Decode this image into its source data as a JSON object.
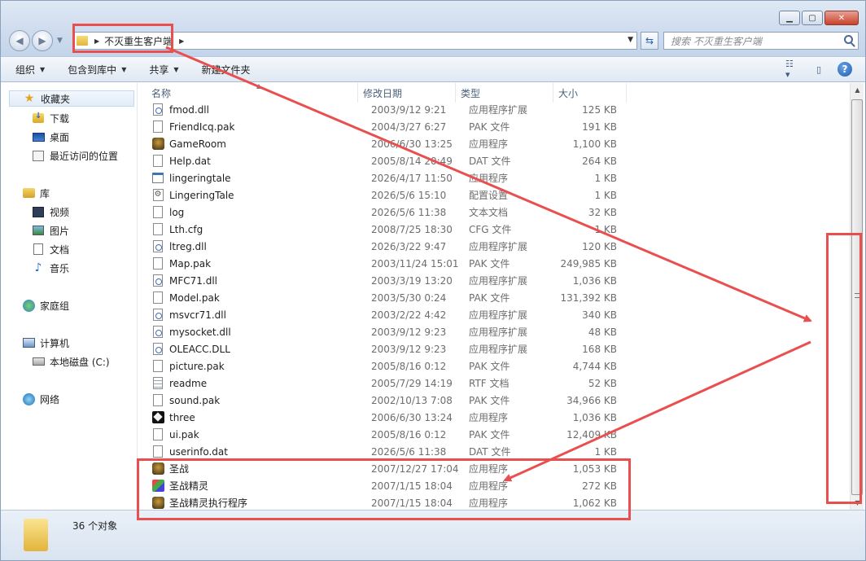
{
  "address": {
    "crumb": "不灭重生客户端"
  },
  "search": {
    "placeholder": "搜索 不灭重生客户端"
  },
  "toolbar": {
    "organize": "组织",
    "include_library": "包含到库中",
    "share": "共享",
    "new_folder": "新建文件夹"
  },
  "sidebar": {
    "favorites": "收藏夹",
    "downloads": "下载",
    "desktop": "桌面",
    "recent": "最近访问的位置",
    "libraries": "库",
    "videos": "视频",
    "pictures": "图片",
    "documents": "文档",
    "music": "音乐",
    "homegroup": "家庭组",
    "computer": "计算机",
    "local_disk": "本地磁盘 (C:)",
    "network": "网络"
  },
  "columns": {
    "name": "名称",
    "date": "修改日期",
    "type": "类型",
    "size": "大小"
  },
  "files": [
    {
      "name": "fmod.dll",
      "date": "2003/9/12 9:21",
      "type": "应用程序扩展",
      "size": "125 KB",
      "icon": "dll"
    },
    {
      "name": "FriendIcq.pak",
      "date": "2004/3/27 6:27",
      "type": "PAK 文件",
      "size": "191 KB",
      "icon": "file"
    },
    {
      "name": "GameRoom",
      "date": "2006/6/30 13:25",
      "type": "应用程序",
      "size": "1,100 KB",
      "icon": "exe"
    },
    {
      "name": "Help.dat",
      "date": "2005/8/14 20:49",
      "type": "DAT 文件",
      "size": "264 KB",
      "icon": "file"
    },
    {
      "name": "lingeringtale",
      "date": "2026/4/17 11:50",
      "type": "应用程序",
      "size": "1 KB",
      "icon": "app"
    },
    {
      "name": "LingeringTale",
      "date": "2026/5/6 15:10",
      "type": "配置设置",
      "size": "1 KB",
      "icon": "cfg"
    },
    {
      "name": "log",
      "date": "2026/5/6 11:38",
      "type": "文本文档",
      "size": "32 KB",
      "icon": "file"
    },
    {
      "name": "Lth.cfg",
      "date": "2008/7/25 18:30",
      "type": "CFG 文件",
      "size": "1 KB",
      "icon": "file"
    },
    {
      "name": "ltreg.dll",
      "date": "2026/3/22 9:47",
      "type": "应用程序扩展",
      "size": "120 KB",
      "icon": "dll"
    },
    {
      "name": "Map.pak",
      "date": "2003/11/24 15:01",
      "type": "PAK 文件",
      "size": "249,985 KB",
      "icon": "file"
    },
    {
      "name": "MFC71.dll",
      "date": "2003/3/19 13:20",
      "type": "应用程序扩展",
      "size": "1,036 KB",
      "icon": "dll"
    },
    {
      "name": "Model.pak",
      "date": "2003/5/30 0:24",
      "type": "PAK 文件",
      "size": "131,392 KB",
      "icon": "file"
    },
    {
      "name": "msvcr71.dll",
      "date": "2003/2/22 4:42",
      "type": "应用程序扩展",
      "size": "340 KB",
      "icon": "dll"
    },
    {
      "name": "mysocket.dll",
      "date": "2003/9/12 9:23",
      "type": "应用程序扩展",
      "size": "48 KB",
      "icon": "dll"
    },
    {
      "name": "OLEACC.DLL",
      "date": "2003/9/12 9:23",
      "type": "应用程序扩展",
      "size": "168 KB",
      "icon": "dll"
    },
    {
      "name": "picture.pak",
      "date": "2005/8/16 0:12",
      "type": "PAK 文件",
      "size": "4,744 KB",
      "icon": "file"
    },
    {
      "name": "readme",
      "date": "2005/7/29 14:19",
      "type": "RTF 文档",
      "size": "52 KB",
      "icon": "txt"
    },
    {
      "name": "sound.pak",
      "date": "2002/10/13 7:08",
      "type": "PAK 文件",
      "size": "34,966 KB",
      "icon": "file"
    },
    {
      "name": "three",
      "date": "2006/6/30 13:24",
      "type": "应用程序",
      "size": "1,036 KB",
      "icon": "three"
    },
    {
      "name": "ui.pak",
      "date": "2005/8/16 0:12",
      "type": "PAK 文件",
      "size": "12,409 KB",
      "icon": "file"
    },
    {
      "name": "userinfo.dat",
      "date": "2026/5/6 11:38",
      "type": "DAT 文件",
      "size": "1 KB",
      "icon": "file"
    },
    {
      "name": "圣战",
      "date": "2007/12/27 17:04",
      "type": "应用程序",
      "size": "1,053 KB",
      "icon": "exe"
    },
    {
      "name": "圣战精灵",
      "date": "2007/1/15 18:04",
      "type": "应用程序",
      "size": "272 KB",
      "icon": "sprite"
    },
    {
      "name": "圣战精灵执行程序",
      "date": "2007/1/15 18:04",
      "type": "应用程序",
      "size": "1,062 KB",
      "icon": "exe"
    }
  ],
  "status": {
    "count": "36 个对象"
  },
  "colors": {
    "annotation": "#ea4f4f"
  }
}
